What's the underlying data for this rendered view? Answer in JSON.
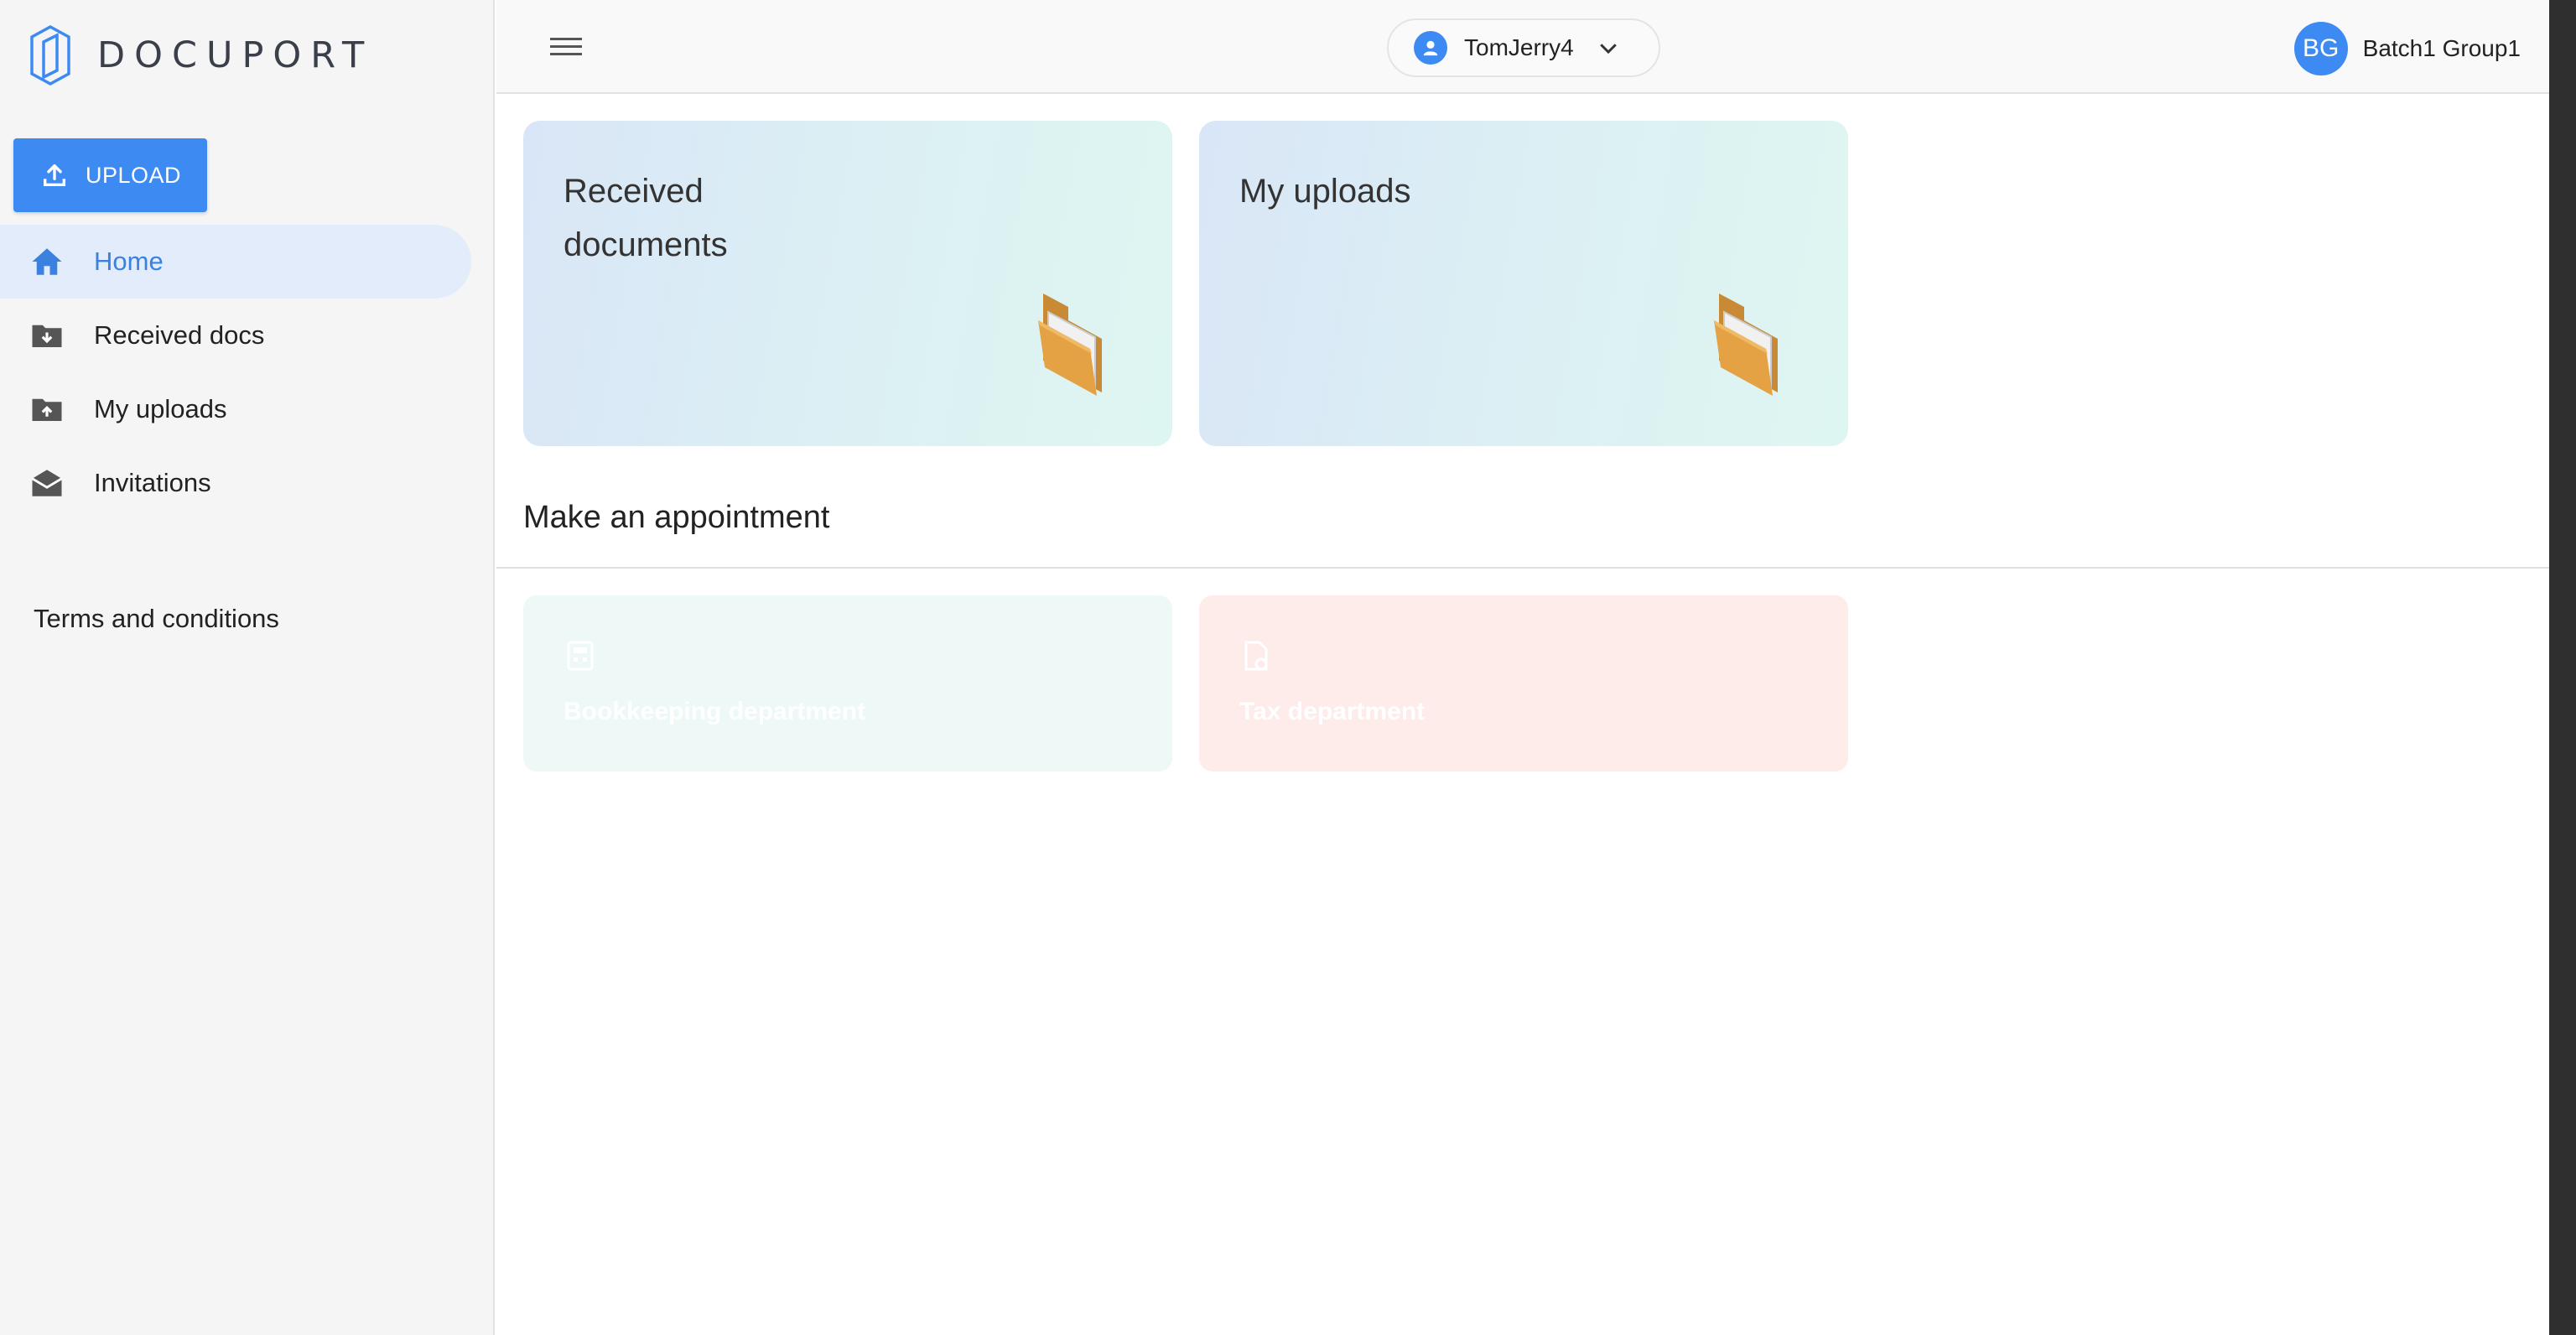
{
  "app": {
    "logo_text": "DOCUPORT"
  },
  "sidebar": {
    "upload_label": "UPLOAD",
    "items": [
      {
        "label": "Home",
        "icon": "home-icon",
        "active": true
      },
      {
        "label": "Received docs",
        "icon": "folder-download-icon",
        "active": false
      },
      {
        "label": "My uploads",
        "icon": "folder-upload-icon",
        "active": false
      },
      {
        "label": "Invitations",
        "icon": "envelope-open-icon",
        "active": false
      }
    ],
    "terms_label": "Terms and conditions"
  },
  "header": {
    "selected_user": "TomJerry4",
    "account_initials": "BG",
    "account_name": "Batch1 Group1"
  },
  "cards": [
    {
      "title": "Received documents",
      "icon": "folder-icon"
    },
    {
      "title": "My uploads",
      "icon": "folder-icon"
    }
  ],
  "appointment": {
    "title": "Make an appointment",
    "departments": [
      {
        "label": "Bookkeeping department",
        "icon": "calculator-icon"
      },
      {
        "label": "Tax department",
        "icon": "document-settings-icon"
      }
    ]
  },
  "colors": {
    "accent": "#3d8bf2",
    "active_nav_bg": "#e2ecfb",
    "bookkeeping_bg": "#eef8f7",
    "tax_bg": "#fdecea"
  }
}
